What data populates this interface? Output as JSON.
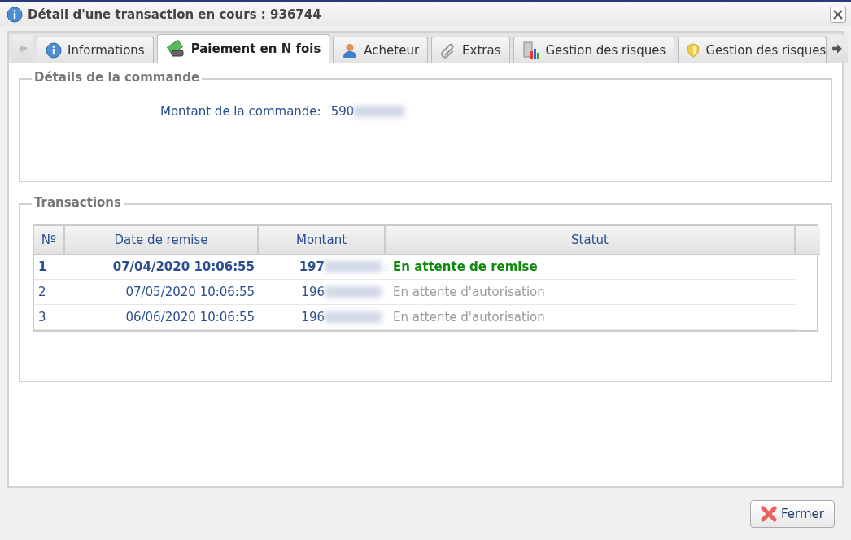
{
  "window": {
    "title": "Détail d'une transaction en cours : 936744"
  },
  "tabs": [
    {
      "label": "Informations",
      "selected": false
    },
    {
      "label": "Paiement en N fois",
      "selected": true
    },
    {
      "label": "Acheteur",
      "selected": false
    },
    {
      "label": "Extras",
      "selected": false
    },
    {
      "label": "Gestion des risques",
      "selected": false
    },
    {
      "label": "Gestion des risques",
      "selected": false
    }
  ],
  "order": {
    "legend": "Détails de la commande",
    "label": "Montant de la commande:",
    "value": "590"
  },
  "transactions": {
    "legend": "Transactions",
    "columns": [
      "Nº",
      "Date de remise",
      "Montant",
      "Statut"
    ],
    "rows": [
      {
        "kind": "current",
        "number": "1",
        "date": "07/04/2020 10:06:55",
        "amount": "197",
        "status": "En attente de remise"
      },
      {
        "kind": "pending",
        "number": "2",
        "date": "07/05/2020 10:06:55",
        "amount": "196",
        "status": "En attente d'autorisation"
      },
      {
        "kind": "pending",
        "number": "3",
        "date": "06/06/2020 10:06:55",
        "amount": "196",
        "status": "En attente d'autorisation"
      }
    ]
  },
  "buttons": [
    {
      "label": "Fermer"
    }
  ]
}
